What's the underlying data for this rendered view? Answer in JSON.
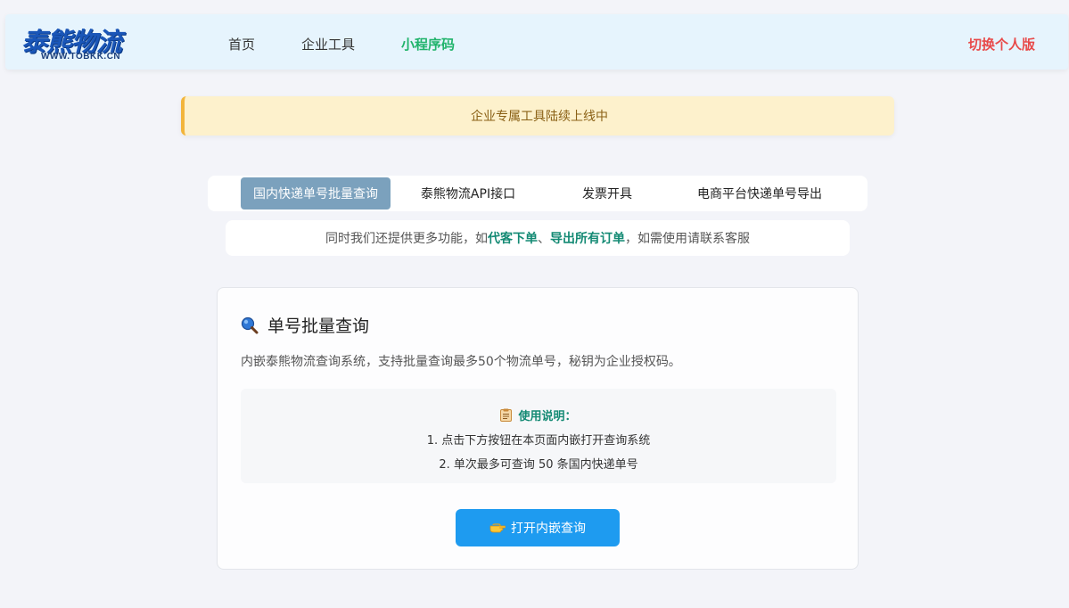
{
  "header": {
    "logo_text": "泰熊物流",
    "logo_sub": "WWW.TOBKK.CN",
    "nav": [
      {
        "label": "首页"
      },
      {
        "label": "企业工具"
      },
      {
        "label": "小程序码"
      }
    ],
    "switch_label": "切换个人版"
  },
  "notice": {
    "text": "企业专属工具陆续上线中"
  },
  "tabs": [
    {
      "label": "国内快递单号批量查询",
      "active": true
    },
    {
      "label": "泰熊物流API接口",
      "active": false
    },
    {
      "label": "发票开具",
      "active": false
    },
    {
      "label": "电商平台快递单号导出",
      "active": false
    }
  ],
  "info": {
    "prefix": "同时我们还提供更多功能，如",
    "highlight1": "代客下单",
    "sep": "、",
    "highlight2": "导出所有订单",
    "suffix": "，如需使用请联系客服"
  },
  "card": {
    "title": "单号批量查询",
    "description": "内嵌泰熊物流查询系统，支持批量查询最多50个物流单号，秘钥为企业授权码。",
    "instructions": {
      "title": "使用说明：",
      "lines": [
        "1. 点击下方按钮在本页面内嵌打开查询系统",
        "2. 单次最多可查询 50 条国内快递单号"
      ]
    },
    "button_label": "打开内嵌查询"
  },
  "colors": {
    "header_bg": "#e6f4fd",
    "nav_active": "#20b36b",
    "switch_link": "#e84a4a",
    "notice_bg": "#fdf1cc",
    "notice_border": "#f2b53c",
    "tab_active_bg": "#7ba1bd",
    "highlight": "#148a74",
    "button_bg": "#1e9bf0"
  },
  "icons": {
    "title_icon": "magnifier-icon",
    "instructions_icon": "clipboard-icon",
    "button_icon": "pointing-hand-icon"
  }
}
